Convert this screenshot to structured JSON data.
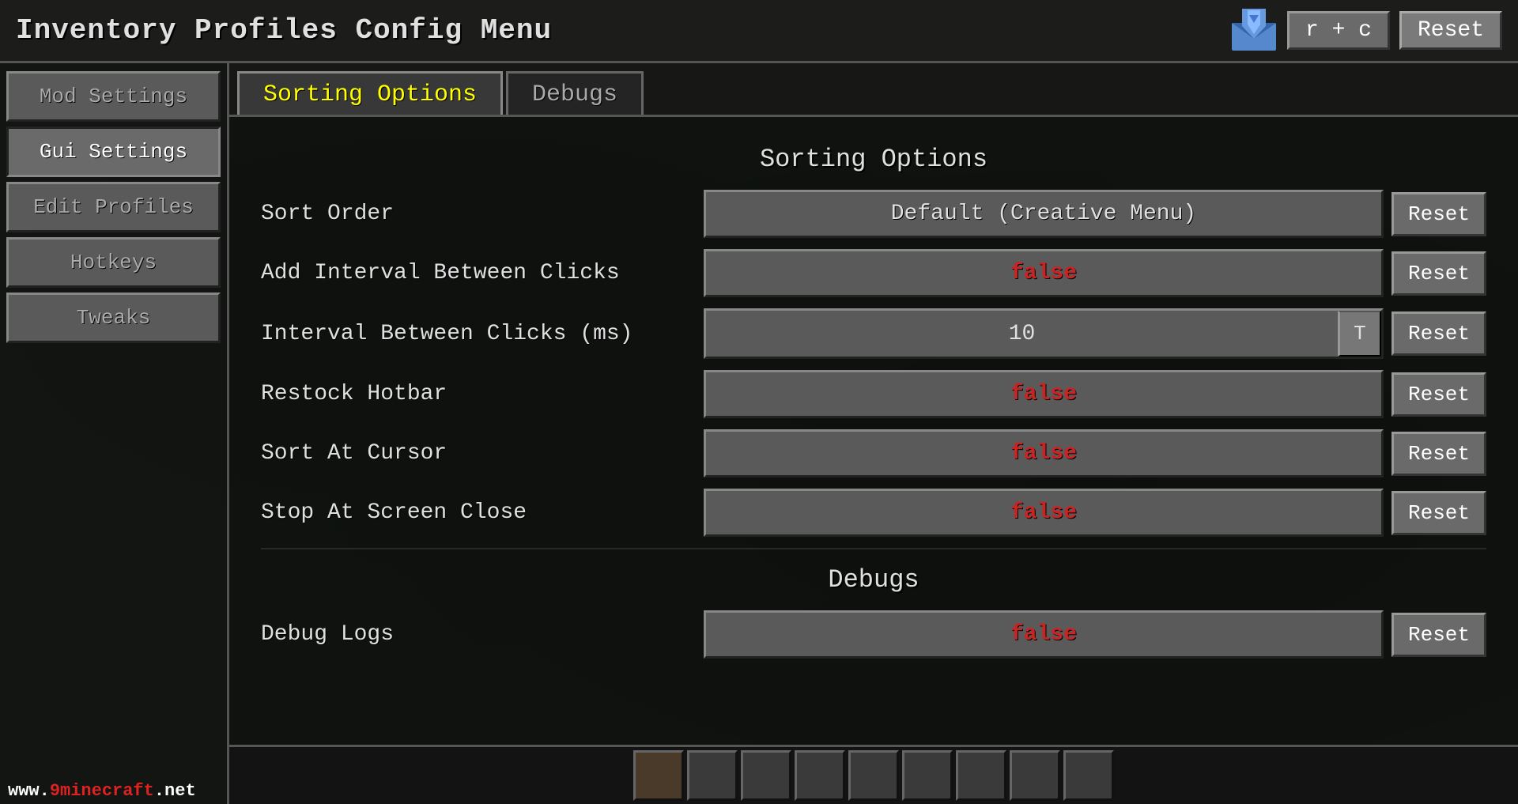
{
  "title": "Inventory Profiles Config Menu",
  "shortcut": "r + c",
  "resetTitle": "Reset",
  "sidebar": {
    "items": [
      {
        "id": "mod-settings",
        "label": "Mod Settings",
        "active": false
      },
      {
        "id": "gui-settings",
        "label": "Gui Settings",
        "active": false
      },
      {
        "id": "edit-profiles",
        "label": "Edit Profiles",
        "active": false
      },
      {
        "id": "hotkeys",
        "label": "Hotkeys",
        "active": false
      },
      {
        "id": "tweaks",
        "label": "Tweaks",
        "active": false
      }
    ]
  },
  "tabs": [
    {
      "id": "sorting-options",
      "label": "Sorting Options",
      "active": true
    },
    {
      "id": "debugs",
      "label": "Debugs",
      "active": false
    }
  ],
  "sortingOptions": {
    "sectionTitle": "Sorting Options",
    "settings": [
      {
        "id": "sort-order",
        "label": "Sort Order",
        "value": "Default (Creative Menu)",
        "isFalse": false,
        "hasT": false,
        "resetLabel": "Reset"
      },
      {
        "id": "add-interval",
        "label": "Add Interval Between Clicks",
        "value": "false",
        "isFalse": true,
        "hasT": false,
        "resetLabel": "Reset"
      },
      {
        "id": "interval-ms",
        "label": "Interval Between Clicks (ms)",
        "value": "10",
        "isFalse": false,
        "hasT": true,
        "tLabel": "T",
        "resetLabel": "Reset"
      },
      {
        "id": "restock-hotbar",
        "label": "Restock Hotbar",
        "value": "false",
        "isFalse": true,
        "hasT": false,
        "resetLabel": "Reset"
      },
      {
        "id": "sort-at-cursor",
        "label": "Sort At Cursor",
        "value": "false",
        "isFalse": true,
        "hasT": false,
        "resetLabel": "Reset"
      },
      {
        "id": "stop-at-screen-close",
        "label": "Stop At Screen Close",
        "value": "false",
        "isFalse": true,
        "hasT": false,
        "resetLabel": "Reset"
      }
    ]
  },
  "debugs": {
    "sectionTitle": "Debugs",
    "settings": [
      {
        "id": "debug-logs",
        "label": "Debug Logs",
        "value": "false",
        "isFalse": true,
        "hasT": false,
        "resetLabel": "Reset"
      }
    ]
  },
  "watermark": {
    "www": "www.",
    "name": "9minecraft",
    "ext": ".net"
  }
}
